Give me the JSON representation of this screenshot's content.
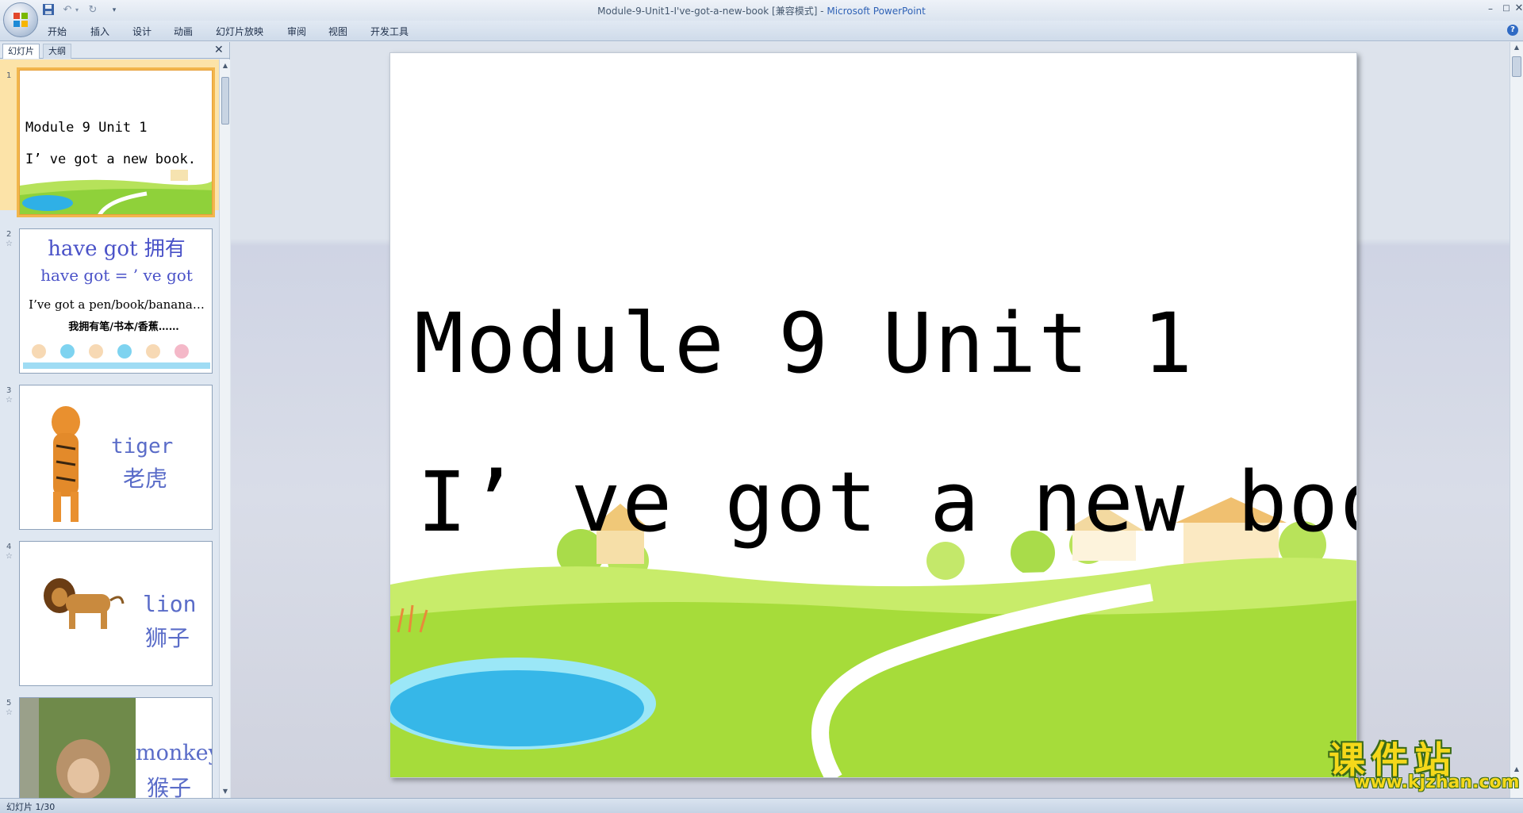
{
  "window": {
    "title_file": "Module-9-Unit1-I've-got-a-new-book [兼容模式] - ",
    "title_app": "Microsoft PowerPoint"
  },
  "ribbon": {
    "tabs": [
      "开始",
      "插入",
      "设计",
      "动画",
      "幻灯片放映",
      "审阅",
      "视图",
      "开发工具"
    ]
  },
  "pane": {
    "tabs": [
      "幻灯片",
      "大纲"
    ]
  },
  "thumbnails": [
    {
      "number": "1",
      "lines": [
        "Module 9 Unit 1",
        "I’ ve got a new book."
      ]
    },
    {
      "number": "2",
      "lines": [
        "have got 拥有",
        "have got = ’ ve got",
        "I’ve got a pen/book/banana…",
        "我拥有笔/书本/香蕉……"
      ]
    },
    {
      "number": "3",
      "word_en": "tiger",
      "word_zh": "老虎"
    },
    {
      "number": "4",
      "word_en": "lion",
      "word_zh": "狮子"
    },
    {
      "number": "5",
      "word_en": "monkey",
      "word_zh": "猴子"
    }
  ],
  "slide": {
    "title": "Module 9 Unit 1",
    "subtitle": "I’ ve got a new book."
  },
  "watermark": {
    "cn": "课件站",
    "url": "www.kjzhan.com"
  },
  "status": {
    "slide_position": "幻灯片 1/30"
  }
}
